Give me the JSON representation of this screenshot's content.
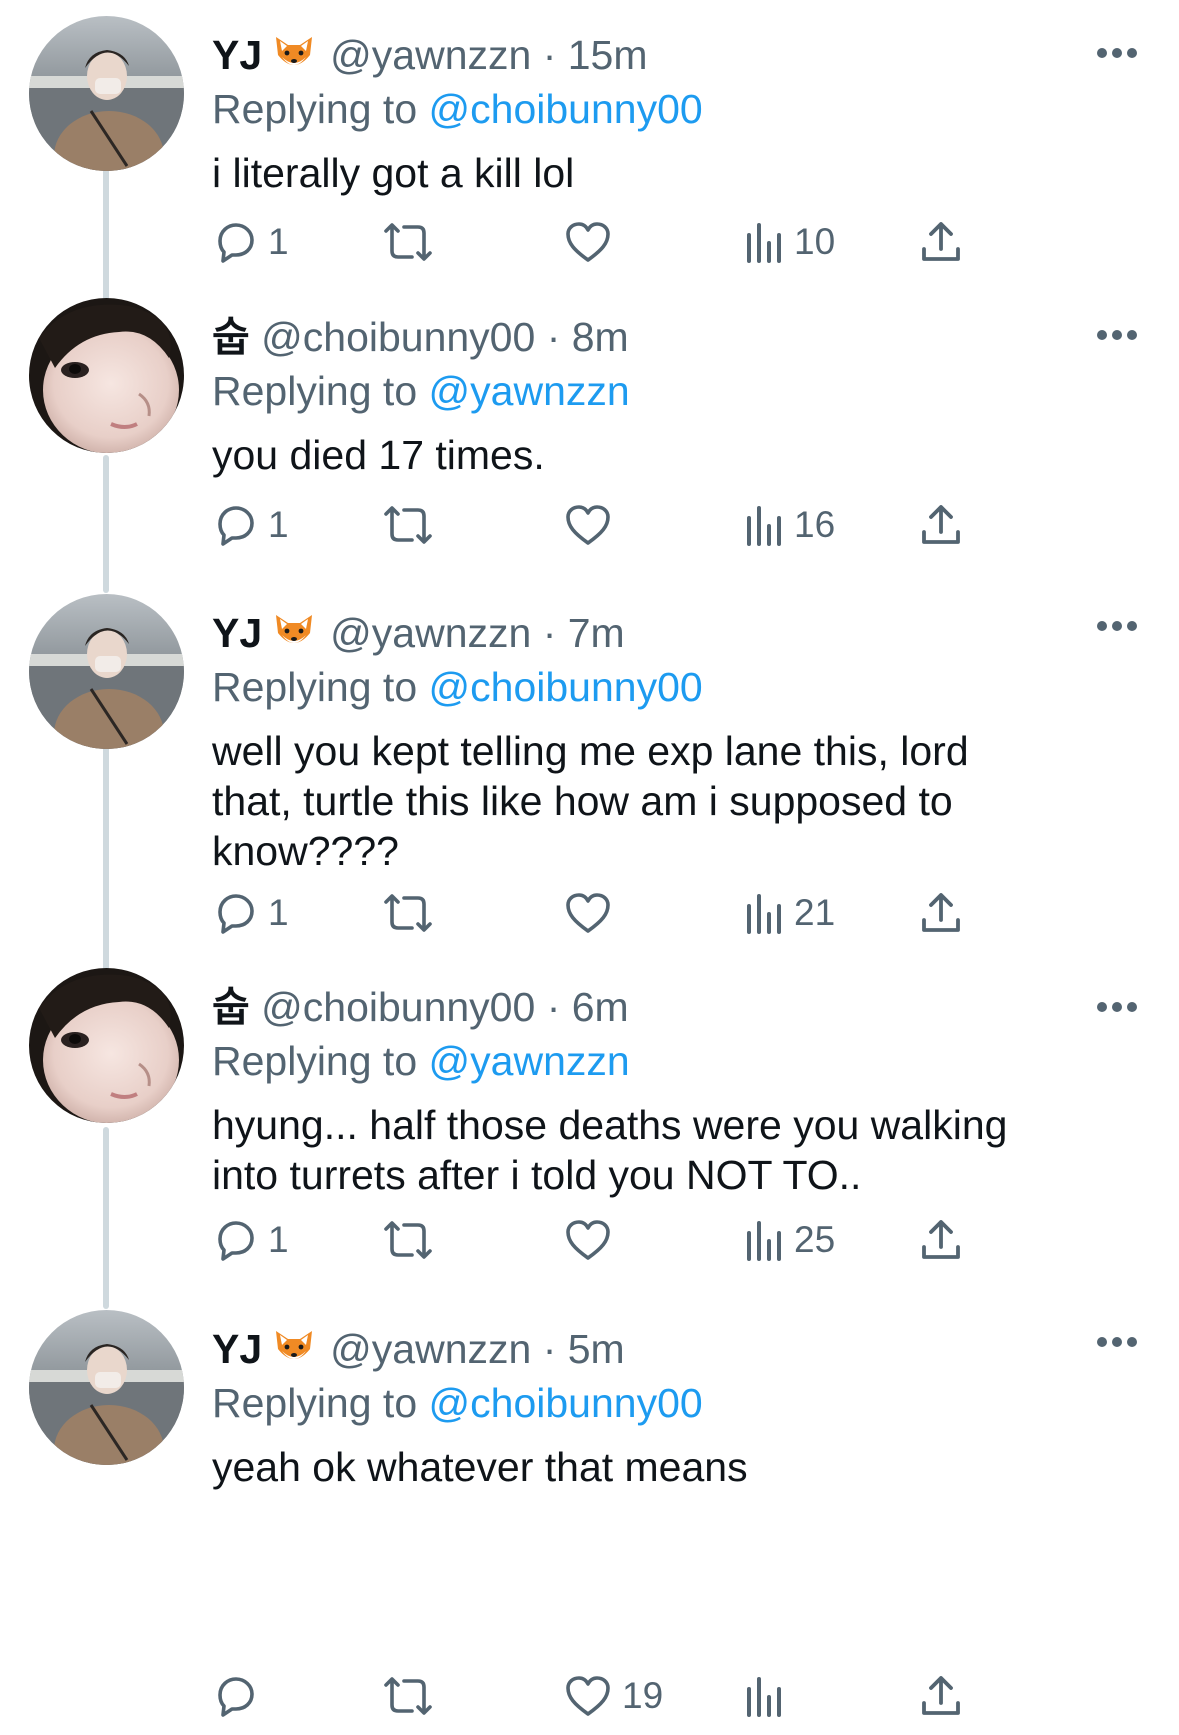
{
  "colors": {
    "text": "#0f1419",
    "secondary": "#536471",
    "mention": "#1d9bf0",
    "thread_line": "#cfd9de"
  },
  "tweets": [
    {
      "display_name": "YJ",
      "display_emoji": "fox-face",
      "handle": "@yawnzzn",
      "time": "· 15m",
      "replying_prefix": "Replying to",
      "replying_to": "@choibunny00",
      "text": "i literally got a kill lol",
      "replies": "1",
      "retweets": "",
      "likes": "",
      "views": "10"
    },
    {
      "display_name": "",
      "name_symbol": "숩",
      "handle": "@choibunny00",
      "time": "· 8m",
      "replying_prefix": "Replying to",
      "replying_to": "@yawnzzn",
      "text": "you died 17 times.",
      "replies": "1",
      "retweets": "",
      "likes": "",
      "views": "16"
    },
    {
      "display_name": "YJ",
      "display_emoji": "fox-face",
      "handle": "@yawnzzn",
      "time": "· 7m",
      "replying_prefix": "Replying to",
      "replying_to": "@choibunny00",
      "text": "well you kept telling me exp lane this, lord\nthat, turtle this like how am i supposed to\nknow????",
      "replies": "1",
      "retweets": "",
      "likes": "",
      "views": "21"
    },
    {
      "display_name": "",
      "name_symbol": "숩",
      "handle": "@choibunny00",
      "time": "· 6m",
      "replying_prefix": "Replying to",
      "replying_to": "@yawnzzn",
      "text": "hyung... half those deaths were you walking\ninto turrets after i told you NOT TO..",
      "replies": "1",
      "retweets": "",
      "likes": "",
      "views": "25"
    },
    {
      "display_name": "YJ",
      "display_emoji": "fox-face",
      "handle": "@yawnzzn",
      "time": "· 5m",
      "replying_prefix": "Replying to",
      "replying_to": "@choibunny00",
      "text": "yeah ok whatever that means",
      "replies": "",
      "retweets": "",
      "likes": "19",
      "views": ""
    }
  ]
}
